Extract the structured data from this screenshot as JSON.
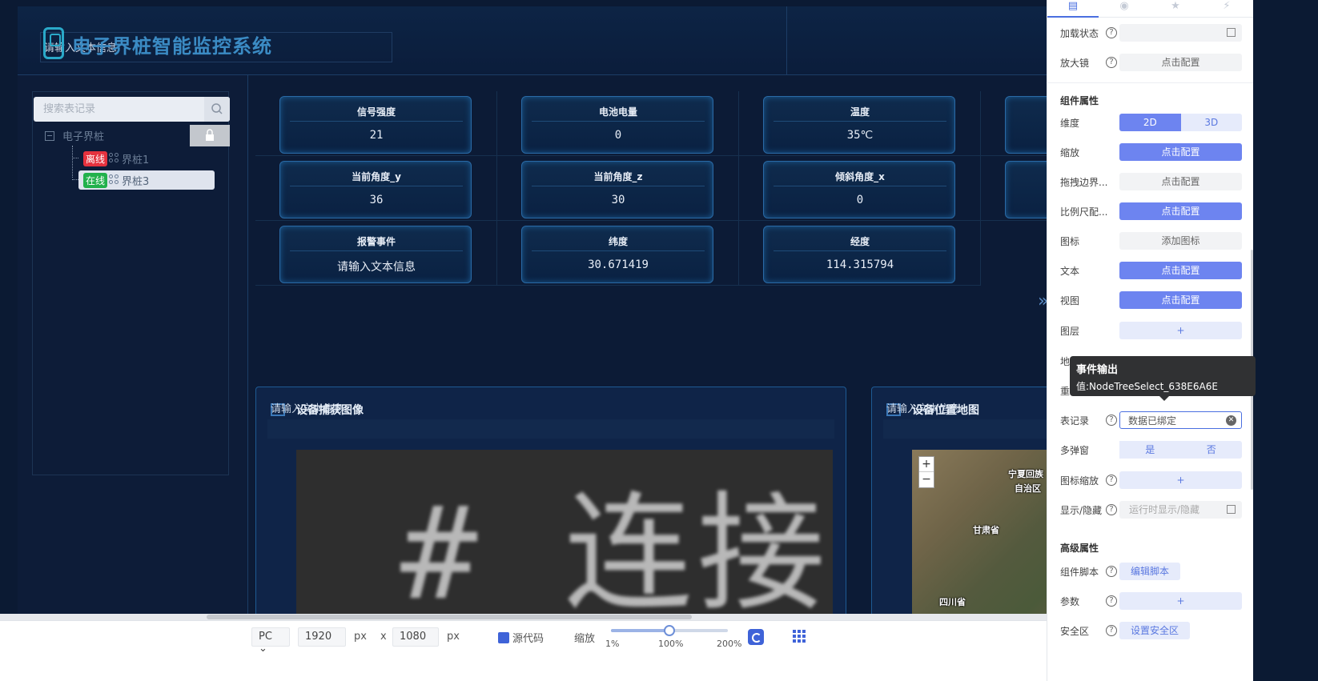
{
  "header": {
    "placeholder": "请输入文本信息",
    "title": "电子界桩智能监控系统"
  },
  "tree": {
    "search_placeholder": "搜索表记录",
    "root_label": "电子界桩",
    "items": [
      {
        "status": "离线",
        "label": "界桩1"
      },
      {
        "status": "在线",
        "label": "界桩3"
      }
    ]
  },
  "cards": [
    {
      "label": "信号强度",
      "value": "21"
    },
    {
      "label": "电池电量",
      "value": "0"
    },
    {
      "label": "温度",
      "value": "35℃"
    },
    {
      "label": "当前角度_y",
      "value": "36"
    },
    {
      "label": "当前角度_z",
      "value": "30"
    },
    {
      "label": "倾斜角度_x",
      "value": "0"
    },
    {
      "label": "报警事件",
      "value": "请输入文本信息"
    },
    {
      "label": "纬度",
      "value": "30.671419"
    },
    {
      "label": "经度",
      "value": "114.315794"
    }
  ],
  "panels": {
    "capture": {
      "placeholder": "请输入文本信息",
      "title": "设备捕获图像",
      "image_text": "# 连接到"
    },
    "map": {
      "placeholder": "请输入文本信息",
      "title": "设备位置地图",
      "zoom_in": "+",
      "zoom_out": "−",
      "labels": [
        "宁夏回族",
        "自治区",
        "甘肃省",
        "四川省"
      ]
    }
  },
  "toolbar": {
    "device": "PC",
    "width": "1920",
    "height": "1080",
    "unit": "px",
    "x": "x",
    "source_code": "源代码",
    "zoom_label": "缩放",
    "zoom_min": "1%",
    "zoom_mid": "100%",
    "zoom_max": "200%",
    "zoom_value": 0.5
  },
  "props": {
    "loading_state": "加载状态",
    "magnifier": "放大镜",
    "configure": "点击配置",
    "component_props": "组件属性",
    "dimension": "维度",
    "dim_2d": "2D",
    "dim_3d": "3D",
    "zoom": "缩放",
    "drag_boundary": "拖拽边界...",
    "scale_config": "比例尺配...",
    "icon": "图标",
    "add_icon": "添加图标",
    "text": "文本",
    "view": "视图",
    "layer": "图层",
    "plus": "+",
    "map_label": "地",
    "reset_label": "重",
    "record": "表记录",
    "record_value": "数据已绑定",
    "multi_popup": "多弹窗",
    "yes": "是",
    "no": "否",
    "icon_zoom": "图标缩放",
    "visibility": "显示/隐藏",
    "visibility_placeholder": "运行时显示/隐藏",
    "advanced": "高级属性",
    "script": "组件脚本",
    "edit_script": "编辑脚本",
    "params": "参数",
    "safe_zone": "安全区",
    "set_safe_zone": "设置安全区"
  },
  "tooltip": {
    "title": "事件输出",
    "value": "值:NodeTreeSelect_638E6A6E"
  },
  "colors": {
    "accent": "#4a6fe0",
    "offline": "#e5323e",
    "online": "#22b14c",
    "title": "#3b8bc4"
  }
}
